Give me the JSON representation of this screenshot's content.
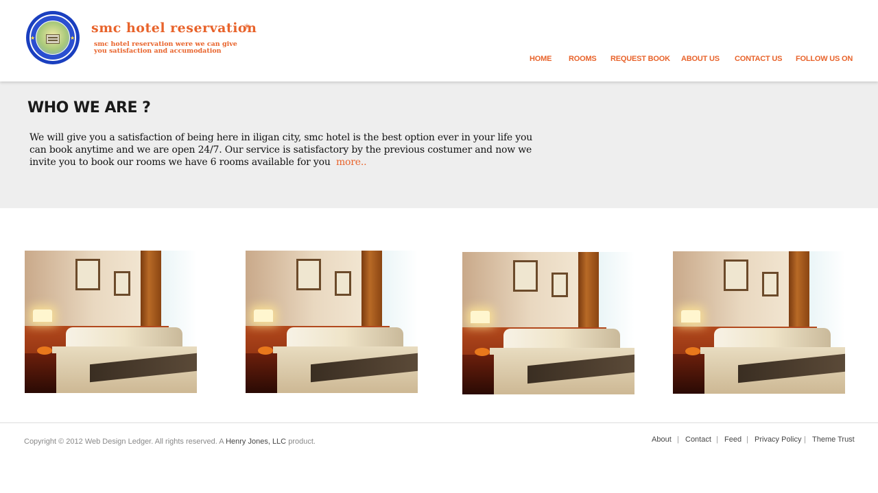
{
  "header": {
    "logo_alt": "St. Michael's College Iligan City logo",
    "site_title": "smc hotel reservation",
    "title_mark": "*",
    "tagline_line1": "smc hotel reservation were we can give",
    "tagline_line2": "you  satisfaction and accumodation"
  },
  "nav": {
    "items": [
      {
        "label": "HOME"
      },
      {
        "label": "ROOMS"
      },
      {
        "label": "REQUEST BOOK"
      },
      {
        "label": "ABOUT US"
      },
      {
        "label": "CONTACT US"
      },
      {
        "label": "FOLLOW US  ON"
      }
    ]
  },
  "about": {
    "title": "WHO WE ARE ?",
    "text": "We will give you a satisfaction of being here in iligan city, smc hotel is the best option ever in your life you can book anytime and we are open 24/7. Our service is satisfactory by the previous costumer and now we invite you to book our rooms we have 6 rooms available for you",
    "more_label": "more.."
  },
  "rooms": {
    "count": 4
  },
  "footer": {
    "copyright_prefix": "Copyright © 2012 Web Design Ledger. All rights reserved. A",
    "company": "Henry Jones, LLC",
    "copyright_suffix": "product.",
    "links": [
      "About",
      "Contact",
      "Feed",
      "Privacy Policy",
      "Theme Trust"
    ],
    "separator": "|"
  },
  "colors": {
    "accent": "#e8632b",
    "section_bg": "#eeeeee",
    "logo_blue": "#1a3fbf"
  }
}
